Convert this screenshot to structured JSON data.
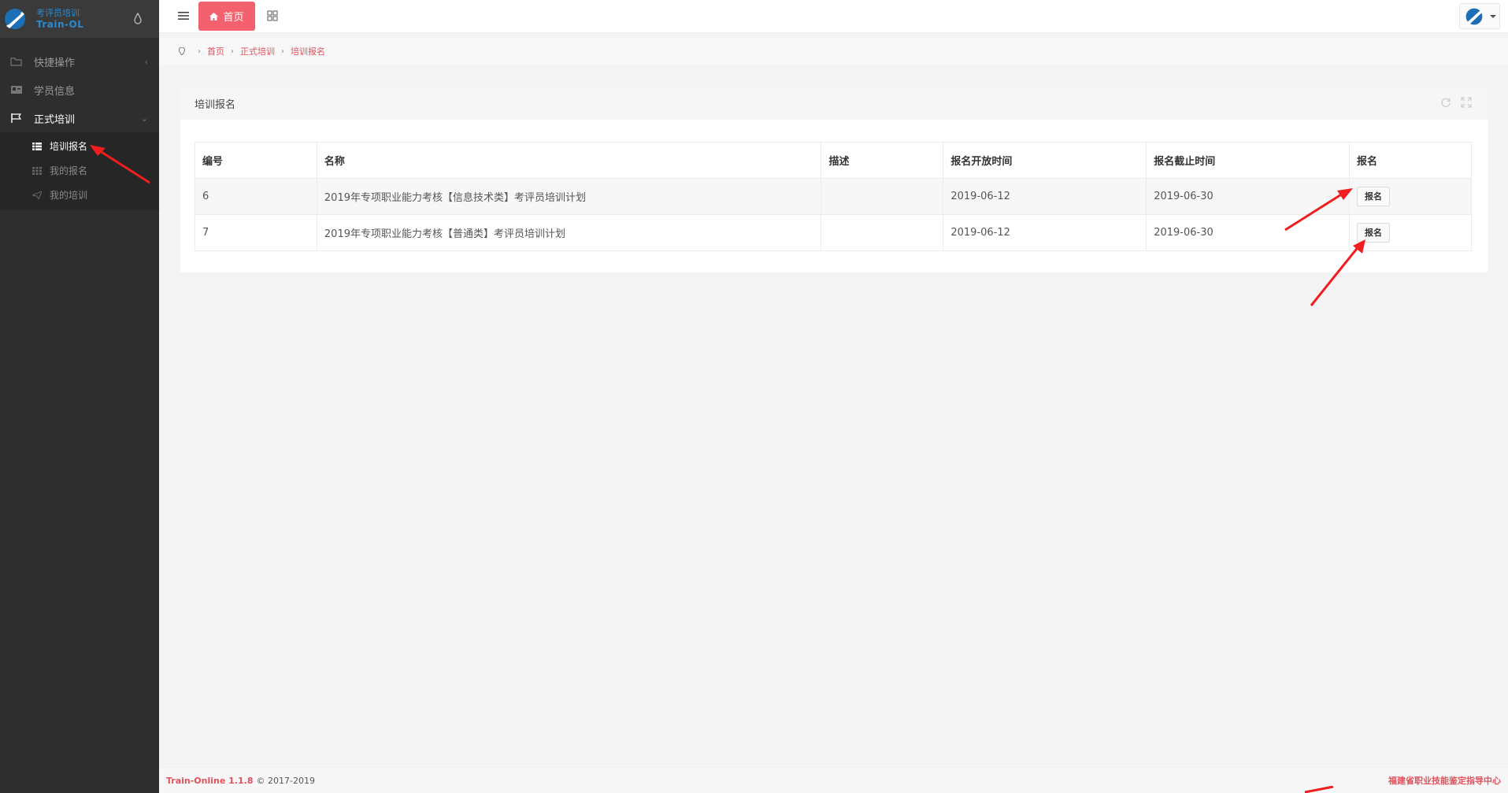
{
  "brand": {
    "title_cn": "考评员培训",
    "title_en": "Train-OL"
  },
  "sidebar": {
    "items": [
      {
        "label": "快捷操作",
        "icon": "folder-icon"
      },
      {
        "label": "学员信息",
        "icon": "id-card-icon"
      },
      {
        "label": "正式培训",
        "icon": "flag-icon",
        "children": [
          {
            "label": "培训报名",
            "icon": "table-icon"
          },
          {
            "label": "我的报名",
            "icon": "grid-icon"
          },
          {
            "label": "我的培训",
            "icon": "paper-plane-icon"
          }
        ]
      }
    ]
  },
  "topbar": {
    "home_tab": "首页"
  },
  "breadcrumb": [
    "首页",
    "正式培训",
    "培训报名"
  ],
  "panel": {
    "title": "培训报名"
  },
  "table": {
    "headers": [
      "编号",
      "名称",
      "描述",
      "报名开放时间",
      "报名截止时间",
      "报名"
    ],
    "rows": [
      {
        "id": "6",
        "name": "2019年专项职业能力考核【信息技术类】考评员培训计划",
        "desc": "",
        "open": "2019-06-12",
        "close": "2019-06-30",
        "action": "报名"
      },
      {
        "id": "7",
        "name": "2019年专项职业能力考核【普通类】考评员培训计划",
        "desc": "",
        "open": "2019-06-12",
        "close": "2019-06-30",
        "action": "报名"
      }
    ]
  },
  "footer": {
    "version": "Train-Online 1.1.8",
    "copyright": "© 2017-2019",
    "org": "福建省职业技能鉴定指导中心"
  },
  "colors": {
    "accent": "#f2616d",
    "sidebar_bg": "#2e2e2e",
    "brand_blue": "#2a8ad0",
    "annotation_arrow": "#f01e1e"
  }
}
